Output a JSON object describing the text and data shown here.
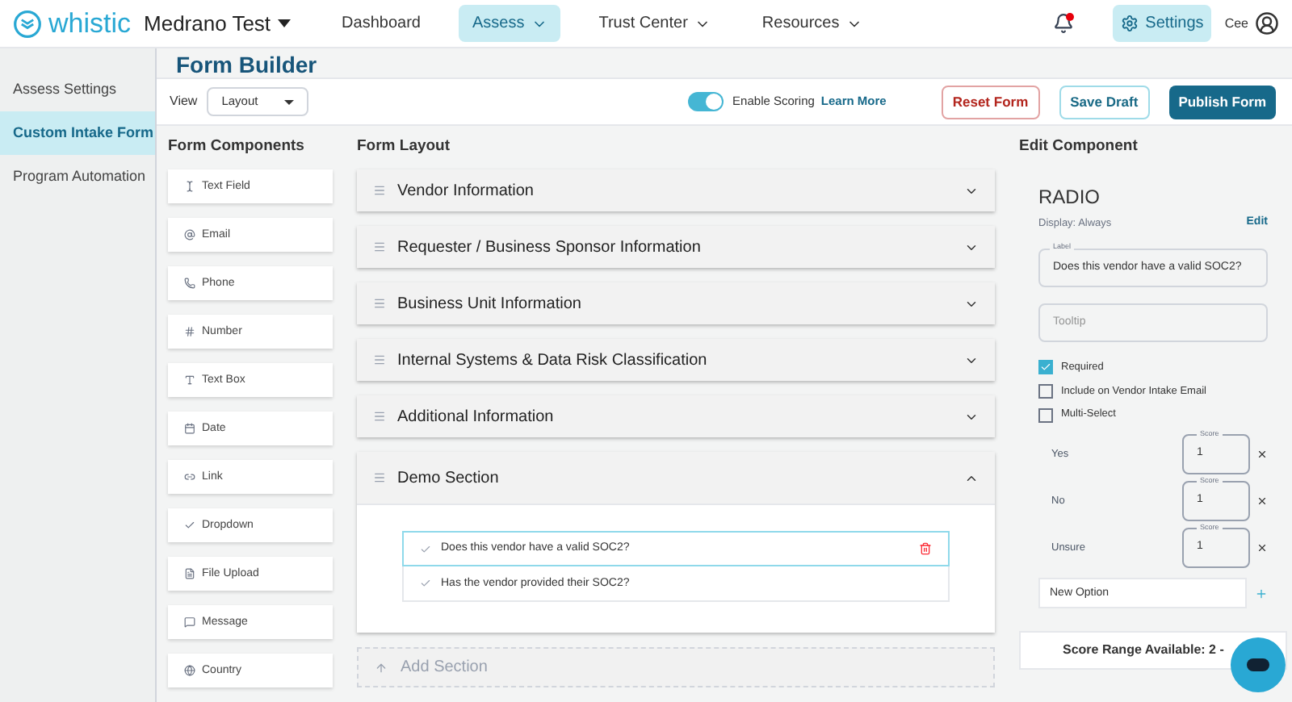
{
  "header": {
    "logo": "whistic",
    "workspace": "Medrano Test",
    "nav": [
      {
        "label": "Dashboard",
        "selected": false,
        "dropdown": false
      },
      {
        "label": "Assess",
        "selected": true,
        "dropdown": true
      },
      {
        "label": "Trust Center",
        "selected": false,
        "dropdown": true
      },
      {
        "label": "Resources",
        "selected": false,
        "dropdown": true
      }
    ],
    "notifications": true,
    "settings": "Settings",
    "user": "Cee"
  },
  "sidebar": {
    "items": [
      {
        "label": "Assess Settings",
        "selected": false
      },
      {
        "label": "Custom Intake Form",
        "selected": true
      },
      {
        "label": "Program Automation",
        "selected": false
      }
    ]
  },
  "page_title": "Form Builder",
  "toolbar": {
    "view_label": "View",
    "view_value": "Layout",
    "scoring": {
      "label": "Enable Scoring",
      "on": true,
      "link": "Learn More"
    },
    "buttons": [
      {
        "label": "Reset Form",
        "kind": "danger"
      },
      {
        "label": "Save Draft",
        "kind": "outline"
      },
      {
        "label": "Publish Form",
        "kind": "primary"
      }
    ]
  },
  "components": {
    "title": "Form Components",
    "items": [
      {
        "label": "Text Field",
        "kind": "text"
      },
      {
        "label": "Email",
        "kind": "email"
      },
      {
        "label": "Phone",
        "kind": "phone"
      },
      {
        "label": "Number",
        "kind": "number"
      },
      {
        "label": "Text Box",
        "kind": "textbox"
      },
      {
        "label": "Date",
        "kind": "date"
      },
      {
        "label": "Link",
        "kind": "link"
      },
      {
        "label": "Dropdown",
        "kind": "dropdown"
      },
      {
        "label": "File Upload",
        "kind": "file"
      },
      {
        "label": "Message",
        "kind": "message"
      },
      {
        "label": "Country",
        "kind": "country"
      }
    ]
  },
  "layout": {
    "title": "Form Layout",
    "sections": [
      {
        "title": "Vendor Information",
        "expanded": false
      },
      {
        "title": "Requester / Business Sponsor Information",
        "expanded": false
      },
      {
        "title": "Business Unit Information",
        "expanded": false
      },
      {
        "title": "Internal Systems & Data Risk Classification",
        "expanded": false
      },
      {
        "title": "Additional Information",
        "expanded": false
      },
      {
        "title": "Demo Section",
        "expanded": true,
        "questions": [
          {
            "label": "Does this vendor have a valid SOC2?",
            "selected": true
          },
          {
            "label": "Has the vendor provided their SOC2?",
            "selected": false
          }
        ]
      }
    ],
    "add_section": "Add Section"
  },
  "edit": {
    "title": "Edit Component",
    "type": "RADIO",
    "display": "Display: Always",
    "edit_link": "Edit",
    "label_caption": "Label",
    "label_value": "Does this vendor have a valid SOC2?",
    "tooltip_placeholder": "Tooltip",
    "checkboxes": [
      {
        "label": "Required",
        "checked": true
      },
      {
        "label": "Include on Vendor Intake Email",
        "checked": false
      },
      {
        "label": "Multi-Select",
        "checked": false
      }
    ],
    "options": [
      {
        "label": "Yes",
        "score_caption": "Score",
        "score": "1"
      },
      {
        "label": "No",
        "score_caption": "Score",
        "score": "1"
      },
      {
        "label": "Unsure",
        "score_caption": "Score",
        "score": "1"
      }
    ],
    "new_option_placeholder": "New Option",
    "score_range": "Score Range Available: 2 -"
  }
}
